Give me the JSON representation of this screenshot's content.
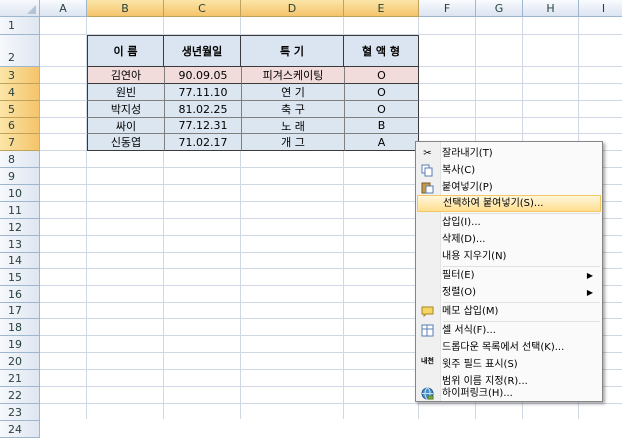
{
  "columns": [
    "A",
    "B",
    "C",
    "D",
    "E",
    "F",
    "G",
    "H",
    "I"
  ],
  "rows": [
    "1",
    "2",
    "3",
    "4",
    "5",
    "6",
    "7",
    "8",
    "9",
    "10",
    "11",
    "12",
    "13",
    "14",
    "15",
    "16",
    "17",
    "18",
    "19",
    "20",
    "21",
    "22",
    "23",
    "24"
  ],
  "table": {
    "headers": [
      "이  름",
      "생년월일",
      "특  기",
      "혈 액 형"
    ],
    "records": [
      [
        "김연아",
        "90.09.05",
        "피겨스케이팅",
        "O"
      ],
      [
        "원빈",
        "77.11.10",
        "연 기",
        "O"
      ],
      [
        "박지성",
        "81.02.25",
        "축 구",
        "O"
      ],
      [
        "싸이",
        "77.12.31",
        "노 래",
        "B"
      ],
      [
        "신동엽",
        "71.02.17",
        "개 그",
        "A"
      ]
    ]
  },
  "context_menu": {
    "items": [
      {
        "label": "잘라내기(T)",
        "icon": "scissors-icon"
      },
      {
        "label": "복사(C)",
        "icon": "copy-icon"
      },
      {
        "label": "붙여넣기(P)",
        "icon": "paste-icon"
      },
      {
        "label": "선택하여 붙여넣기(S)...",
        "icon": ""
      },
      {
        "label": "삽입(I)...",
        "icon": ""
      },
      {
        "label": "삭제(D)...",
        "icon": ""
      },
      {
        "label": "내용 지우기(N)",
        "icon": ""
      },
      {
        "label": "필터(E)",
        "icon": "",
        "submenu": true
      },
      {
        "label": "정렬(O)",
        "icon": "",
        "submenu": true
      },
      {
        "label": "메모 삽입(M)",
        "icon": "comment-icon"
      },
      {
        "label": "셀 서식(F)...",
        "icon": "format-cells-icon"
      },
      {
        "label": "드롭다운 목록에서 선택(K)...",
        "icon": ""
      },
      {
        "label": "윗주 필드 표시(S)",
        "icon": "phonetic-icon"
      },
      {
        "label": "범위 이름 지정(R)...",
        "icon": ""
      },
      {
        "label": "하이퍼링크(H)...",
        "icon": "hyperlink-icon"
      }
    ],
    "phonetic_icon_text": "내천",
    "colors": {
      "highlight": "#ffdf8f",
      "header_fill": "#dbe5f1",
      "first_row_fill": "#f2dcdb",
      "row_fill": "#dce6f1"
    }
  }
}
